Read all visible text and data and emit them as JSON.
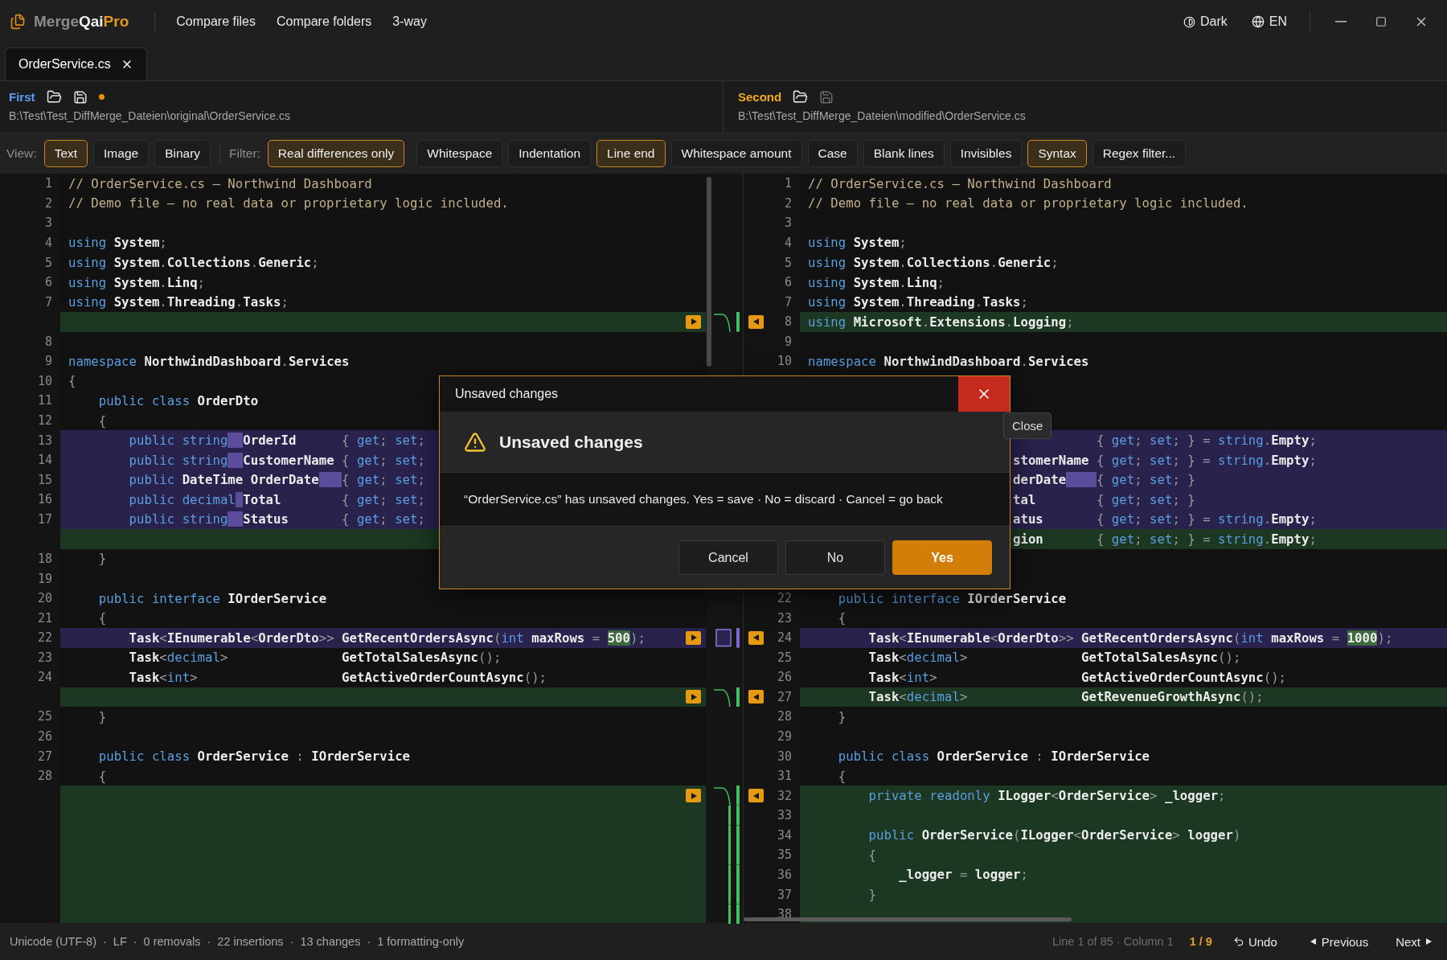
{
  "app": {
    "brand": [
      {
        "text": "Merge",
        "kind": "muted"
      },
      {
        "text": "Qai",
        "kind": "strong"
      },
      {
        "text": "Pro",
        "kind": "accent"
      }
    ],
    "nav": [
      "Compare files",
      "Compare folders",
      "3-way"
    ],
    "theme": "Dark",
    "language": "EN"
  },
  "tabs": [
    {
      "label": "OrderService.cs",
      "selected": true
    }
  ],
  "files": [
    {
      "label": "First",
      "color": "#5b9df5",
      "unsaved": true,
      "save_enabled": true,
      "path": "B:\\Test\\Test_DiffMerge_Dateien\\original\\OrderService.cs"
    },
    {
      "label": "Second",
      "color": "#f0a81c",
      "unsaved": false,
      "save_enabled": false,
      "path": "B:\\Test\\Test_DiffMerge_Dateien\\modified\\OrderService.cs"
    }
  ],
  "toolbar": {
    "view_label": "View:",
    "views": [
      {
        "label": "Text",
        "selected": true
      },
      {
        "label": "Image",
        "selected": false
      },
      {
        "label": "Binary",
        "selected": false
      }
    ],
    "filter_label": "Filter:",
    "filters": [
      {
        "label": "Real differences only",
        "on": true
      },
      {
        "label": "Whitespace",
        "on": false
      },
      {
        "label": "Indentation",
        "on": false
      },
      {
        "label": "Line end",
        "on": true
      },
      {
        "label": "Whitespace amount",
        "on": false
      },
      {
        "label": "Case",
        "on": false
      },
      {
        "label": "Blank lines",
        "on": false
      },
      {
        "label": "Invisibles",
        "on": false
      },
      {
        "label": "Syntax",
        "on": true
      },
      {
        "label": "Regex filter...",
        "on": false
      }
    ]
  },
  "diff": {
    "rows": [
      {
        "left": {
          "n": "1",
          "kind": "same",
          "tokens": [
            {
              "text": "// OrderService.cs — Northwind Dashboard",
              "kind": "comment"
            }
          ]
        },
        "right": {
          "n": "1",
          "kind": "same",
          "tokens": [
            {
              "text": "// OrderService.cs — Northwind Dashboard",
              "kind": "comment"
            }
          ]
        }
      },
      {
        "left": {
          "n": "2",
          "kind": "same",
          "tokens": [
            {
              "text": "// Demo file — no real data or proprietary logic included.",
              "kind": "comment"
            }
          ]
        },
        "right": {
          "n": "2",
          "kind": "same",
          "tokens": [
            {
              "text": "// Demo file — no real data or proprietary logic included.",
              "kind": "comment"
            }
          ]
        }
      },
      {
        "left": {
          "n": "3",
          "kind": "same"
        },
        "right": {
          "n": "3",
          "kind": "same"
        }
      },
      {
        "left": {
          "n": "4",
          "kind": "same",
          "tokens": [
            {
              "text": "using",
              "kind": "keyword"
            },
            {
              "text": " System",
              "kind": "identifier"
            },
            {
              "text": ";",
              "kind": "punct"
            }
          ]
        },
        "right": {
          "n": "4",
          "kind": "same",
          "tokens": [
            {
              "text": "using",
              "kind": "keyword"
            },
            {
              "text": " System",
              "kind": "identifier"
            },
            {
              "text": ";",
              "kind": "punct"
            }
          ]
        }
      },
      {
        "left": {
          "n": "5",
          "kind": "same",
          "tokens": [
            {
              "text": "using",
              "kind": "keyword"
            },
            {
              "text": " System",
              "kind": "identifier"
            },
            {
              "text": ".",
              "kind": "punct"
            },
            {
              "text": "Collections",
              "kind": "identifier"
            },
            {
              "text": ".",
              "kind": "punct"
            },
            {
              "text": "Generic",
              "kind": "identifier"
            },
            {
              "text": ";",
              "kind": "punct"
            }
          ]
        },
        "right": {
          "n": "5",
          "kind": "same",
          "tokens": [
            {
              "text": "using",
              "kind": "keyword"
            },
            {
              "text": " System",
              "kind": "identifier"
            },
            {
              "text": ".",
              "kind": "punct"
            },
            {
              "text": "Collections",
              "kind": "identifier"
            },
            {
              "text": ".",
              "kind": "punct"
            },
            {
              "text": "Generic",
              "kind": "identifier"
            },
            {
              "text": ";",
              "kind": "punct"
            }
          ]
        }
      },
      {
        "left": {
          "n": "6",
          "kind": "same",
          "tokens": [
            {
              "text": "using",
              "kind": "keyword"
            },
            {
              "text": " System",
              "kind": "identifier"
            },
            {
              "text": ".",
              "kind": "punct"
            },
            {
              "text": "Linq",
              "kind": "identifier"
            },
            {
              "text": ";",
              "kind": "punct"
            }
          ]
        },
        "right": {
          "n": "6",
          "kind": "same",
          "tokens": [
            {
              "text": "using",
              "kind": "keyword"
            },
            {
              "text": " System",
              "kind": "identifier"
            },
            {
              "text": ".",
              "kind": "punct"
            },
            {
              "text": "Linq",
              "kind": "identifier"
            },
            {
              "text": ";",
              "kind": "punct"
            }
          ]
        }
      },
      {
        "left": {
          "n": "7",
          "kind": "same",
          "tokens": [
            {
              "text": "using",
              "kind": "keyword"
            },
            {
              "text": " System",
              "kind": "identifier"
            },
            {
              "text": ".",
              "kind": "punct"
            },
            {
              "text": "Threading",
              "kind": "identifier"
            },
            {
              "text": ".",
              "kind": "punct"
            },
            {
              "text": "Tasks",
              "kind": "identifier"
            },
            {
              "text": ";",
              "kind": "punct"
            }
          ]
        },
        "right": {
          "n": "7",
          "kind": "same",
          "tokens": [
            {
              "text": "using",
              "kind": "keyword"
            },
            {
              "text": " System",
              "kind": "identifier"
            },
            {
              "text": ".",
              "kind": "punct"
            },
            {
              "text": "Threading",
              "kind": "identifier"
            },
            {
              "text": ".",
              "kind": "punct"
            },
            {
              "text": "Tasks",
              "kind": "identifier"
            },
            {
              "text": ";",
              "kind": "punct"
            }
          ]
        }
      },
      {
        "left": {
          "kind": "added"
        },
        "right": {
          "n": "8",
          "kind": "added",
          "tokens": [
            {
              "text": "using",
              "kind": "keyword"
            },
            {
              "text": " Microsoft",
              "kind": "identifier"
            },
            {
              "text": ".",
              "kind": "punct"
            },
            {
              "text": "Extensions",
              "kind": "identifier"
            },
            {
              "text": ".",
              "kind": "punct"
            },
            {
              "text": "Logging",
              "kind": "identifier"
            },
            {
              "text": ";",
              "kind": "punct"
            }
          ]
        },
        "arrows": true,
        "kind": "added"
      },
      {
        "left": {
          "n": "8",
          "kind": "same"
        },
        "right": {
          "n": "9",
          "kind": "same"
        }
      },
      {
        "left": {
          "n": "9",
          "kind": "same",
          "tokens": [
            {
              "text": "namespace",
              "kind": "keyword"
            },
            {
              "text": " NorthwindDashboard",
              "kind": "identifier"
            },
            {
              "text": ".",
              "kind": "punct"
            },
            {
              "text": "Services",
              "kind": "identifier"
            }
          ]
        },
        "right": {
          "n": "10",
          "kind": "same",
          "tokens": [
            {
              "text": "namespace",
              "kind": "keyword"
            },
            {
              "text": " NorthwindDashboard",
              "kind": "identifier"
            },
            {
              "text": ".",
              "kind": "punct"
            },
            {
              "text": "Services",
              "kind": "identifier"
            }
          ]
        }
      },
      {
        "left": {
          "n": "10",
          "kind": "same",
          "tokens": [
            {
              "text": "{",
              "kind": "punct"
            }
          ]
        },
        "right": {
          "kind": "same"
        }
      },
      {
        "left": {
          "n": "11",
          "kind": "same",
          "tokens": [
            {
              "text": "    public",
              "kind": "keyword"
            },
            {
              "text": " class",
              "kind": "keyword"
            },
            {
              "text": " OrderDto",
              "kind": "identifier"
            }
          ]
        },
        "right": {
          "kind": "same"
        }
      },
      {
        "left": {
          "n": "12",
          "kind": "same",
          "tokens": [
            {
              "text": "    {",
              "kind": "punct"
            }
          ]
        },
        "right": {
          "kind": "same"
        }
      },
      {
        "left": {
          "n": "13",
          "kind": "changed",
          "tokens": [
            {
              "text": "        public",
              "kind": "keyword"
            },
            {
              "text": " string",
              "kind": "keyword"
            },
            {
              "text": "  OrderId",
              "kind": "gap-identifier"
            },
            {
              "text": "      {",
              "kind": "punct"
            },
            {
              "text": " get",
              "kind": "keyword"
            },
            {
              "text": ";",
              "kind": "punct"
            },
            {
              "text": " set",
              "kind": "keyword"
            },
            {
              "text": ";",
              "kind": "punct"
            }
          ]
        },
        "right": {
          "kind": "changed",
          "tokens": [
            {
              "text": "                                      {",
              "kind": "punct"
            },
            {
              "text": " get",
              "kind": "keyword"
            },
            {
              "text": ";",
              "kind": "punct"
            },
            {
              "text": " set",
              "kind": "keyword"
            },
            {
              "text": ";",
              "kind": "punct"
            },
            {
              "text": " } =",
              "kind": "punct"
            },
            {
              "text": " string",
              "kind": "keyword"
            },
            {
              "text": ".",
              "kind": "punct"
            },
            {
              "text": "Empty",
              "kind": "identifier"
            },
            {
              "text": ";",
              "kind": "punct"
            }
          ]
        }
      },
      {
        "left": {
          "n": "14",
          "kind": "changed",
          "tokens": [
            {
              "text": "        public",
              "kind": "keyword"
            },
            {
              "text": " string",
              "kind": "keyword"
            },
            {
              "text": "  CustomerName",
              "kind": "gap-identifier"
            },
            {
              "text": " {",
              "kind": "punct"
            },
            {
              "text": " get",
              "kind": "keyword"
            },
            {
              "text": ";",
              "kind": "punct"
            },
            {
              "text": " set",
              "kind": "keyword"
            },
            {
              "text": ";",
              "kind": "punct"
            }
          ]
        },
        "right": {
          "kind": "changed",
          "tokens": [
            {
              "text": "                           stomerName",
              "kind": "identifier"
            },
            {
              "text": " {",
              "kind": "punct"
            },
            {
              "text": " get",
              "kind": "keyword"
            },
            {
              "text": ";",
              "kind": "punct"
            },
            {
              "text": " set",
              "kind": "keyword"
            },
            {
              "text": ";",
              "kind": "punct"
            },
            {
              "text": " } =",
              "kind": "punct"
            },
            {
              "text": " string",
              "kind": "keyword"
            },
            {
              "text": ".",
              "kind": "punct"
            },
            {
              "text": "Empty",
              "kind": "identifier"
            },
            {
              "text": ";",
              "kind": "punct"
            }
          ]
        }
      },
      {
        "left": {
          "n": "15",
          "kind": "changed",
          "tokens": [
            {
              "text": "        public",
              "kind": "keyword"
            },
            {
              "text": " DateTime",
              "kind": "identifier"
            },
            {
              "text": " OrderDate",
              "kind": "identifier"
            },
            {
              "text": "   {",
              "kind": "gap-punct"
            },
            {
              "text": " get",
              "kind": "keyword"
            },
            {
              "text": ";",
              "kind": "punct"
            },
            {
              "text": " set",
              "kind": "keyword"
            },
            {
              "text": ";",
              "kind": "punct"
            }
          ]
        },
        "right": {
          "kind": "changed",
          "tokens": [
            {
              "text": "                           derDate",
              "kind": "identifier"
            },
            {
              "text": "    {",
              "kind": "gap-punct"
            },
            {
              "text": " get",
              "kind": "keyword"
            },
            {
              "text": ";",
              "kind": "punct"
            },
            {
              "text": " set",
              "kind": "keyword"
            },
            {
              "text": ";",
              "kind": "punct"
            },
            {
              "text": " }",
              "kind": "punct"
            }
          ]
        }
      },
      {
        "left": {
          "n": "16",
          "kind": "changed",
          "tokens": [
            {
              "text": "        public",
              "kind": "keyword"
            },
            {
              "text": " decimal",
              "kind": "keyword"
            },
            {
              "text": " Total",
              "kind": "gap-identifier"
            },
            {
              "text": "        {",
              "kind": "punct"
            },
            {
              "text": " get",
              "kind": "keyword"
            },
            {
              "text": ";",
              "kind": "punct"
            },
            {
              "text": " set",
              "kind": "keyword"
            },
            {
              "text": ";",
              "kind": "punct"
            }
          ]
        },
        "right": {
          "kind": "changed",
          "tokens": [
            {
              "text": "                           tal",
              "kind": "identifier"
            },
            {
              "text": "        {",
              "kind": "punct"
            },
            {
              "text": " get",
              "kind": "keyword"
            },
            {
              "text": ";",
              "kind": "punct"
            },
            {
              "text": " set",
              "kind": "keyword"
            },
            {
              "text": ";",
              "kind": "punct"
            },
            {
              "text": " }",
              "kind": "punct"
            }
          ]
        }
      },
      {
        "left": {
          "n": "17",
          "kind": "changed",
          "tokens": [
            {
              "text": "        public",
              "kind": "keyword"
            },
            {
              "text": " string",
              "kind": "keyword"
            },
            {
              "text": "  Status",
              "kind": "gap-identifier"
            },
            {
              "text": "       {",
              "kind": "punct"
            },
            {
              "text": " get",
              "kind": "keyword"
            },
            {
              "text": ";",
              "kind": "punct"
            },
            {
              "text": " set",
              "kind": "keyword"
            },
            {
              "text": ";",
              "kind": "punct"
            }
          ]
        },
        "right": {
          "kind": "changed",
          "tokens": [
            {
              "text": "                           atus",
              "kind": "identifier"
            },
            {
              "text": "       {",
              "kind": "punct"
            },
            {
              "text": " get",
              "kind": "keyword"
            },
            {
              "text": ";",
              "kind": "punct"
            },
            {
              "text": " set",
              "kind": "keyword"
            },
            {
              "text": ";",
              "kind": "punct"
            },
            {
              "text": " } =",
              "kind": "punct"
            },
            {
              "text": " string",
              "kind": "keyword"
            },
            {
              "text": ".",
              "kind": "punct"
            },
            {
              "text": "Empty",
              "kind": "identifier"
            },
            {
              "text": ";",
              "kind": "punct"
            }
          ]
        }
      },
      {
        "left": {
          "kind": "added"
        },
        "right": {
          "kind": "added",
          "tokens": [
            {
              "text": "                           gion",
              "kind": "identifier"
            },
            {
              "text": "       {",
              "kind": "punct"
            },
            {
              "text": " get",
              "kind": "keyword"
            },
            {
              "text": ";",
              "kind": "punct"
            },
            {
              "text": " set",
              "kind": "keyword"
            },
            {
              "text": ";",
              "kind": "punct"
            },
            {
              "text": " } =",
              "kind": "punct"
            },
            {
              "text": " string",
              "kind": "keyword"
            },
            {
              "text": ".",
              "kind": "punct"
            },
            {
              "text": "Empty",
              "kind": "identifier"
            },
            {
              "text": ";",
              "kind": "punct"
            }
          ]
        }
      },
      {
        "left": {
          "n": "18",
          "kind": "same",
          "tokens": [
            {
              "text": "    }",
              "kind": "punct"
            }
          ]
        },
        "right": {
          "kind": "same"
        }
      },
      {
        "left": {
          "n": "19",
          "kind": "same"
        },
        "right": {
          "kind": "same"
        }
      },
      {
        "left": {
          "n": "20",
          "kind": "same",
          "tokens": [
            {
              "text": "    public",
              "kind": "keyword"
            },
            {
              "text": " interface",
              "kind": "keyword"
            },
            {
              "text": " IOrderService",
              "kind": "identifier"
            }
          ]
        },
        "right": {
          "n": "22",
          "kind": "same",
          "tokens": [
            {
              "text": "    public",
              "kind": "keyword"
            },
            {
              "text": " interface",
              "kind": "keyword"
            },
            {
              "text": " IOrderService",
              "kind": "identifier"
            }
          ]
        }
      },
      {
        "left": {
          "n": "21",
          "kind": "same",
          "tokens": [
            {
              "text": "    {",
              "kind": "punct"
            }
          ]
        },
        "right": {
          "n": "23",
          "kind": "same",
          "tokens": [
            {
              "text": "    {",
              "kind": "punct"
            }
          ]
        }
      },
      {
        "left": {
          "n": "22",
          "kind": "changed",
          "tokens": [
            {
              "text": "        Task",
              "kind": "identifier"
            },
            {
              "text": "<",
              "kind": "punct"
            },
            {
              "text": "IEnumerable",
              "kind": "identifier"
            },
            {
              "text": "<",
              "kind": "punct"
            },
            {
              "text": "OrderDto",
              "kind": "identifier"
            },
            {
              "text": ">>",
              "kind": "punct"
            },
            {
              "text": " GetRecentOrdersAsync",
              "kind": "identifier"
            },
            {
              "text": "(",
              "kind": "punct"
            },
            {
              "text": "int",
              "kind": "keyword"
            },
            {
              "text": " maxRows",
              "kind": "identifier"
            },
            {
              "text": " = ",
              "kind": "punct"
            },
            {
              "text": "500",
              "kind": "changed-number"
            },
            {
              "text": ");",
              "kind": "punct"
            }
          ]
        },
        "right": {
          "n": "24",
          "kind": "changed",
          "tokens": [
            {
              "text": "        Task",
              "kind": "identifier"
            },
            {
              "text": "<",
              "kind": "punct"
            },
            {
              "text": "IEnumerable",
              "kind": "identifier"
            },
            {
              "text": "<",
              "kind": "punct"
            },
            {
              "text": "OrderDto",
              "kind": "identifier"
            },
            {
              "text": ">>",
              "kind": "punct"
            },
            {
              "text": " GetRecentOrdersAsync",
              "kind": "identifier"
            },
            {
              "text": "(",
              "kind": "punct"
            },
            {
              "text": "int",
              "kind": "keyword"
            },
            {
              "text": " maxRows",
              "kind": "identifier"
            },
            {
              "text": " = ",
              "kind": "punct"
            },
            {
              "text": "1000",
              "kind": "changed-number"
            },
            {
              "text": ");",
              "kind": "punct"
            }
          ]
        },
        "arrows": true,
        "kind": "changed"
      },
      {
        "left": {
          "n": "23",
          "kind": "same",
          "tokens": [
            {
              "text": "        Task",
              "kind": "identifier"
            },
            {
              "text": "<",
              "kind": "punct"
            },
            {
              "text": "decimal",
              "kind": "keyword"
            },
            {
              "text": ">",
              "kind": "punct"
            },
            {
              "text": "               GetTotalSalesAsync",
              "kind": "identifier"
            },
            {
              "text": "();",
              "kind": "punct"
            }
          ]
        },
        "right": {
          "n": "25",
          "kind": "same",
          "tokens": [
            {
              "text": "        Task",
              "kind": "identifier"
            },
            {
              "text": "<",
              "kind": "punct"
            },
            {
              "text": "decimal",
              "kind": "keyword"
            },
            {
              "text": ">",
              "kind": "punct"
            },
            {
              "text": "               GetTotalSalesAsync",
              "kind": "identifier"
            },
            {
              "text": "();",
              "kind": "punct"
            }
          ]
        }
      },
      {
        "left": {
          "n": "24",
          "kind": "same",
          "tokens": [
            {
              "text": "        Task",
              "kind": "identifier"
            },
            {
              "text": "<",
              "kind": "punct"
            },
            {
              "text": "int",
              "kind": "keyword"
            },
            {
              "text": ">",
              "kind": "punct"
            },
            {
              "text": "                   GetActiveOrderCountAsync",
              "kind": "identifier"
            },
            {
              "text": "();",
              "kind": "punct"
            }
          ]
        },
        "right": {
          "n": "26",
          "kind": "same",
          "tokens": [
            {
              "text": "        Task",
              "kind": "identifier"
            },
            {
              "text": "<",
              "kind": "punct"
            },
            {
              "text": "int",
              "kind": "keyword"
            },
            {
              "text": ">",
              "kind": "punct"
            },
            {
              "text": "                   GetActiveOrderCountAsync",
              "kind": "identifier"
            },
            {
              "text": "();",
              "kind": "punct"
            }
          ]
        }
      },
      {
        "left": {
          "kind": "added"
        },
        "right": {
          "n": "27",
          "kind": "added",
          "tokens": [
            {
              "text": "        Task",
              "kind": "identifier"
            },
            {
              "text": "<",
              "kind": "punct"
            },
            {
              "text": "decimal",
              "kind": "keyword"
            },
            {
              "text": ">",
              "kind": "punct"
            },
            {
              "text": "               GetRevenueGrowthAsync",
              "kind": "identifier"
            },
            {
              "text": "();",
              "kind": "punct"
            }
          ]
        },
        "arrows": true,
        "kind": "added"
      },
      {
        "left": {
          "n": "25",
          "kind": "same",
          "tokens": [
            {
              "text": "    }",
              "kind": "punct"
            }
          ]
        },
        "right": {
          "n": "28",
          "kind": "same",
          "tokens": [
            {
              "text": "    }",
              "kind": "punct"
            }
          ]
        }
      },
      {
        "left": {
          "n": "26",
          "kind": "same"
        },
        "right": {
          "n": "29",
          "kind": "same"
        }
      },
      {
        "left": {
          "n": "27",
          "kind": "same",
          "tokens": [
            {
              "text": "    public",
              "kind": "keyword"
            },
            {
              "text": " class",
              "kind": "keyword"
            },
            {
              "text": " OrderService",
              "kind": "identifier"
            },
            {
              "text": " :",
              "kind": "punct"
            },
            {
              "text": " IOrderService",
              "kind": "identifier"
            }
          ]
        },
        "right": {
          "n": "30",
          "kind": "same",
          "tokens": [
            {
              "text": "    public",
              "kind": "keyword"
            },
            {
              "text": " class",
              "kind": "keyword"
            },
            {
              "text": " OrderService",
              "kind": "identifier"
            },
            {
              "text": " :",
              "kind": "punct"
            },
            {
              "text": " IOrderService",
              "kind": "identifier"
            }
          ]
        }
      },
      {
        "left": {
          "n": "28",
          "kind": "same",
          "tokens": [
            {
              "text": "    {",
              "kind": "punct"
            }
          ]
        },
        "right": {
          "n": "31",
          "kind": "same",
          "tokens": [
            {
              "text": "    {",
              "kind": "punct"
            }
          ]
        }
      },
      {
        "left": {
          "kind": "added"
        },
        "right": {
          "n": "32",
          "kind": "added",
          "tokens": [
            {
              "text": "        private",
              "kind": "keyword"
            },
            {
              "text": " readonly",
              "kind": "keyword"
            },
            {
              "text": " ILogger",
              "kind": "identifier"
            },
            {
              "text": "<",
              "kind": "punct"
            },
            {
              "text": "OrderService",
              "kind": "identifier"
            },
            {
              "text": ">",
              "kind": "punct"
            },
            {
              "text": " _logger",
              "kind": "identifier"
            },
            {
              "text": ";",
              "kind": "punct"
            }
          ]
        },
        "arrows": true,
        "kind": "added"
      },
      {
        "left": {
          "kind": "added"
        },
        "right": {
          "n": "33",
          "kind": "added"
        },
        "kind": "tail"
      },
      {
        "left": {
          "kind": "added"
        },
        "right": {
          "n": "34",
          "kind": "added",
          "tokens": [
            {
              "text": "        public",
              "kind": "keyword"
            },
            {
              "text": " OrderService",
              "kind": "identifier"
            },
            {
              "text": "(",
              "kind": "punct"
            },
            {
              "text": "ILogger",
              "kind": "identifier"
            },
            {
              "text": "<",
              "kind": "punct"
            },
            {
              "text": "OrderService",
              "kind": "identifier"
            },
            {
              "text": ">",
              "kind": "punct"
            },
            {
              "text": " logger",
              "kind": "identifier"
            },
            {
              "text": ")",
              "kind": "punct"
            }
          ]
        },
        "kind": "tail"
      },
      {
        "left": {
          "kind": "added"
        },
        "right": {
          "n": "35",
          "kind": "added",
          "tokens": [
            {
              "text": "        {",
              "kind": "punct"
            }
          ]
        },
        "kind": "tail"
      },
      {
        "left": {
          "kind": "added"
        },
        "right": {
          "n": "36",
          "kind": "added",
          "tokens": [
            {
              "text": "            _logger",
              "kind": "identifier"
            },
            {
              "text": " =",
              "kind": "punct"
            },
            {
              "text": " logger",
              "kind": "identifier"
            },
            {
              "text": ";",
              "kind": "punct"
            }
          ]
        },
        "kind": "tail"
      },
      {
        "left": {
          "kind": "added"
        },
        "right": {
          "n": "37",
          "kind": "added",
          "tokens": [
            {
              "text": "        }",
              "kind": "punct"
            }
          ]
        },
        "kind": "tail"
      },
      {
        "left": {
          "kind": "added"
        },
        "right": {
          "n": "38",
          "kind": "added"
        },
        "kind": "tail"
      }
    ]
  },
  "dialog": {
    "title": "Unsaved changes",
    "heading": "Unsaved changes",
    "message": "“OrderService.cs” has unsaved changes. Yes = save · No = discard · Cancel = go back",
    "close_tooltip": "Close",
    "buttons": [
      {
        "label": "Cancel",
        "kind": "secondary"
      },
      {
        "label": "No",
        "kind": "secondary"
      },
      {
        "label": "Yes",
        "kind": "primary"
      }
    ]
  },
  "status_bar": {
    "separator": "·",
    "stats": [
      "Unicode (UTF-8)",
      "LF",
      "0 removals",
      "22 insertions",
      "13 changes",
      "1 formatting-only"
    ],
    "position": "Line 1 of 85 · Column 1",
    "counter": "1 / 9",
    "undo": "Undo",
    "previous": "Previous",
    "next": "Next"
  }
}
